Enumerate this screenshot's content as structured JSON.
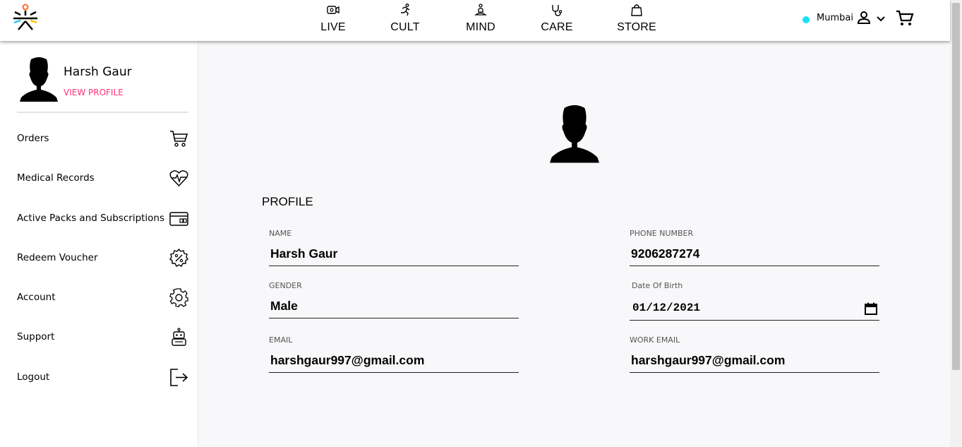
{
  "colors": {
    "accent_pink": "#ff3278",
    "city_dot": "#19e3f0",
    "logo_orange": "#ff6a2b",
    "logo_teal": "#1ec8dc",
    "logo_yellow": "#ffc107"
  },
  "header": {
    "nav": [
      {
        "label": "LIVE",
        "icon": "video-camera-icon"
      },
      {
        "label": "CULT",
        "icon": "running-person-icon"
      },
      {
        "label": "MIND",
        "icon": "meditation-icon"
      },
      {
        "label": "CARE",
        "icon": "stethoscope-icon"
      },
      {
        "label": "STORE",
        "icon": "shopping-bag-icon"
      }
    ],
    "city": "Mumbai"
  },
  "sidebar": {
    "name": "Harsh Gaur",
    "view_profile": "VIEW PROFILE",
    "items": [
      {
        "label": "Orders",
        "icon": "cart-icon"
      },
      {
        "label": "Medical Records",
        "icon": "heart-pulse-icon"
      },
      {
        "label": "Active Packs and Subscriptions",
        "icon": "card-icon"
      },
      {
        "label": "Redeem Voucher",
        "icon": "voucher-percent-icon"
      },
      {
        "label": "Account",
        "icon": "gear-icon"
      },
      {
        "label": "Support",
        "icon": "robot-icon"
      },
      {
        "label": "Logout",
        "icon": "logout-icon"
      }
    ]
  },
  "profile": {
    "title": "PROFILE",
    "name_label": "NAME",
    "name": "Harsh Gaur",
    "phone_label": "PHONE NUMBER",
    "phone": "9206287274",
    "gender_label": "GENDER",
    "gender": "Male",
    "dob_label": "Date Of Birth",
    "dob": "01/12/2021",
    "email_label": "EMAIL",
    "email": "harshgaur997@gmail.com",
    "work_email_label": "WORK EMAIL",
    "work_email": "harshgaur997@gmail.com"
  }
}
